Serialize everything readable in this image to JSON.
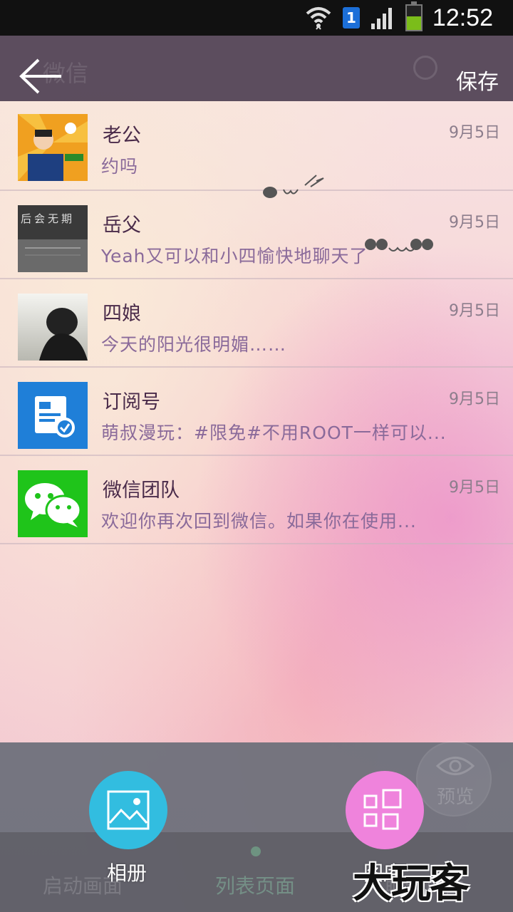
{
  "status_bar": {
    "time": "12:52",
    "sim_slot": "1",
    "icons": [
      "wifi-icon",
      "sim-icon",
      "signal-icon",
      "battery-icon"
    ]
  },
  "header": {
    "ghost_title": "微信",
    "save_label": "保存"
  },
  "chats": [
    {
      "name": "老公",
      "message": "约吗",
      "date": "9月5日"
    },
    {
      "name": "岳父",
      "message": "Yeah又可以和小四愉快地聊天了",
      "date": "9月5日",
      "avatar_text": "后会无期"
    },
    {
      "name": "四娘",
      "message": "今天的阳光很明媚……",
      "date": "9月5日"
    },
    {
      "name": "订阅号",
      "message": "萌叔漫玩：#限免#不用ROOT一样可以...",
      "date": "9月5日"
    },
    {
      "name": "微信团队",
      "message": "欢迎你再次回到微信。如果你在使用...",
      "date": "9月5日"
    }
  ],
  "bottom": {
    "preview_label": "预览",
    "album_label": "相册",
    "gallery_label": "图库",
    "ghost_tabs": [
      "启动画面",
      "列表页面",
      "聊天页面"
    ],
    "watermark": "大玩客"
  },
  "colors": {
    "album_fab": "#32bde0",
    "gallery_fab": "#ef83dc",
    "topbar": "#4e4052",
    "wechat_green": "#1fc41a",
    "subscription_blue": "#1f7fd8"
  }
}
